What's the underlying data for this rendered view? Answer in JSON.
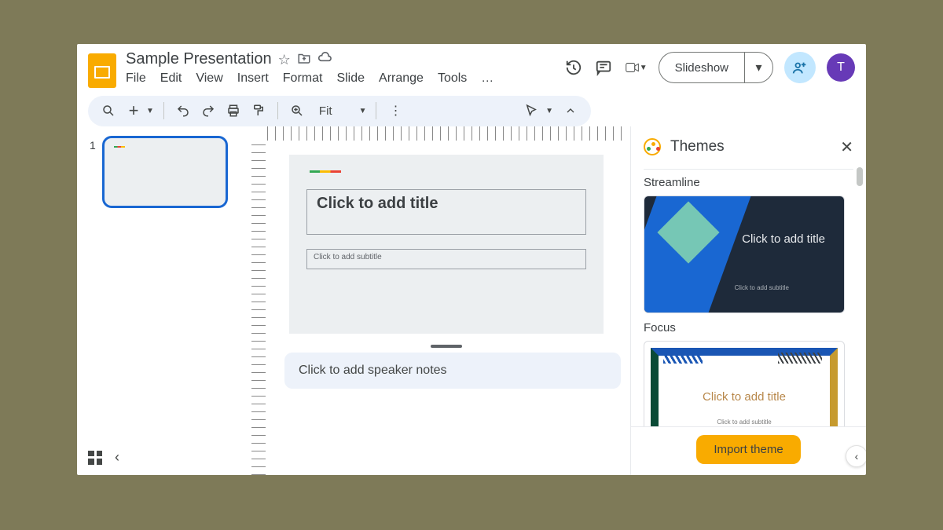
{
  "doc": {
    "title": "Sample Presentation"
  },
  "menubar": [
    "File",
    "Edit",
    "View",
    "Insert",
    "Format",
    "Slide",
    "Arrange",
    "Tools",
    "…"
  ],
  "toolbar": {
    "zoom_label": "Fit"
  },
  "topbar": {
    "slideshow_label": "Slideshow",
    "avatar_initial": "T"
  },
  "filmstrip": {
    "slides": [
      {
        "number": "1"
      }
    ]
  },
  "canvas": {
    "title_placeholder": "Click to add title",
    "subtitle_placeholder": "Click to add subtitle"
  },
  "speaker_notes": {
    "placeholder": "Click to add speaker notes"
  },
  "themes": {
    "panel_title": "Themes",
    "import_label": "Import theme",
    "items": [
      {
        "name": "Streamline",
        "title_ph": "Click to add title",
        "subtitle_ph": "Click to add subtitle"
      },
      {
        "name": "Focus",
        "title_ph": "Click to add title",
        "subtitle_ph": "Click to add subtitle"
      }
    ]
  }
}
